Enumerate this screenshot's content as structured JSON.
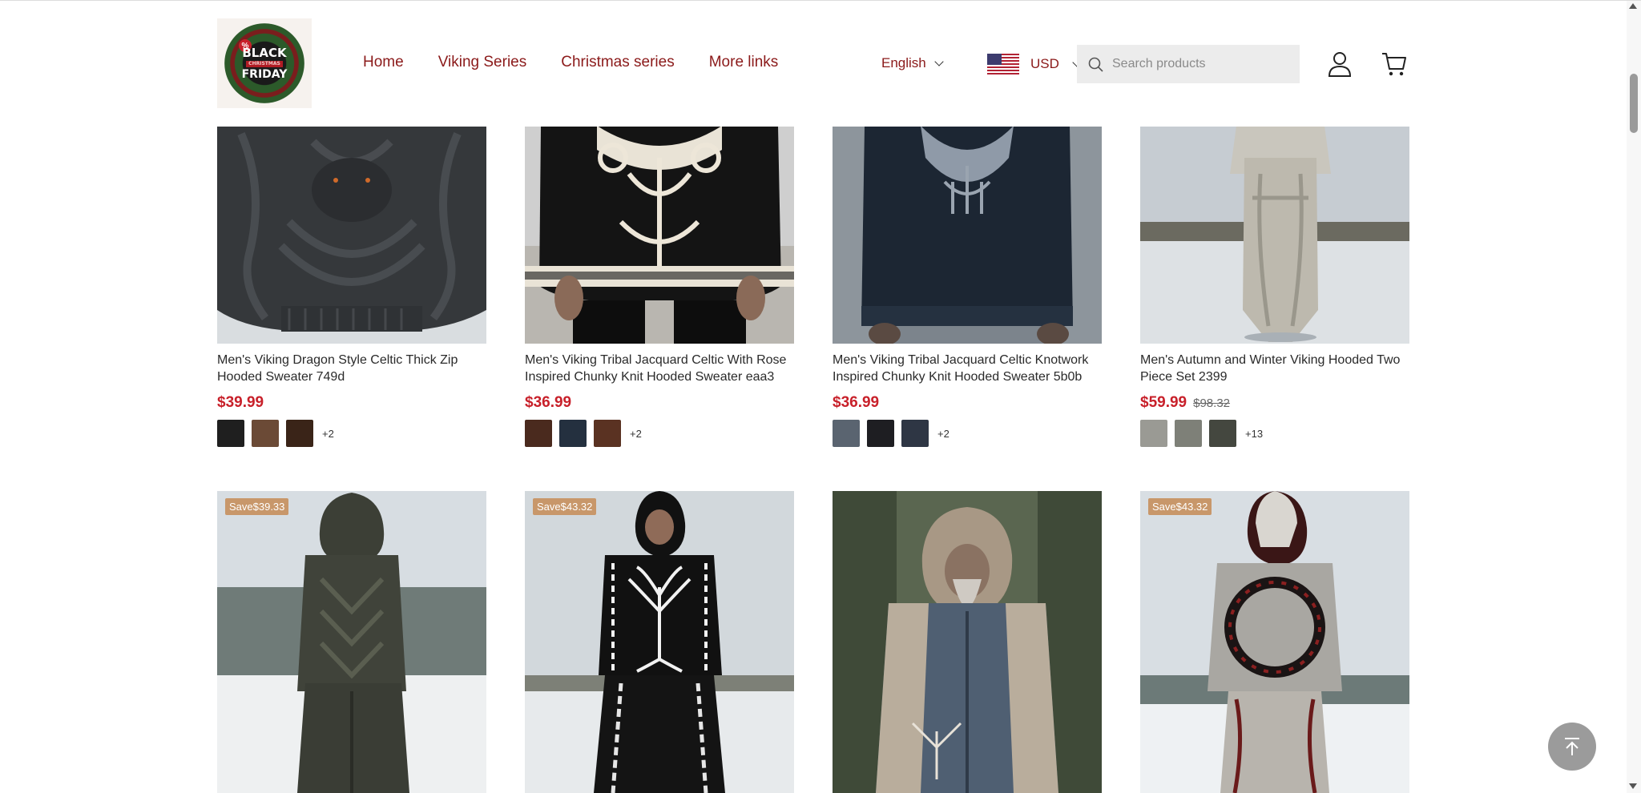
{
  "header": {
    "logo": {
      "line1": "BLACK",
      "line2": "CHRISTMAS",
      "line3": "FRIDAY",
      "percent": "%"
    },
    "nav": [
      {
        "label": "Home"
      },
      {
        "label": "Viking Series"
      },
      {
        "label": "Christmas series"
      },
      {
        "label": "More links"
      }
    ],
    "language": "English",
    "currency": "USD",
    "search": {
      "placeholder": "Search products",
      "value": ""
    }
  },
  "products_row1": [
    {
      "title": "Men's Viking Dragon Style Celtic Thick Zip Hooded Sweater 749d",
      "price": "$39.99",
      "old_price": "",
      "more_colors": "+2",
      "swatches": [
        "#1f1f1f",
        "#6b4a36",
        "#3a2418"
      ]
    },
    {
      "title": "Men's Viking Tribal Jacquard Celtic With Rose Inspired Chunky Knit Hooded Sweater eaa3",
      "price": "$36.99",
      "old_price": "",
      "more_colors": "+2",
      "swatches": [
        "#4a2a1e",
        "#24303f",
        "#5a3222"
      ]
    },
    {
      "title": "Men's Viking Tribal Jacquard Celtic Knotwork Inspired Chunky Knit Hooded Sweater 5b0b",
      "price": "$36.99",
      "old_price": "",
      "more_colors": "+2",
      "swatches": [
        "#5a6470",
        "#1e1e22",
        "#2e3644"
      ]
    },
    {
      "title": "Men's Autumn and Winter Viking Hooded Two Piece Set 2399",
      "price": "$59.99",
      "old_price": "$98.32",
      "more_colors": "+13",
      "swatches": [
        "#9a9a94",
        "#7e8078",
        "#44473f"
      ]
    }
  ],
  "products_row2": [
    {
      "badge": "Save$39.33"
    },
    {
      "badge": "Save$43.32"
    },
    {
      "badge": ""
    },
    {
      "badge": "Save$43.32"
    }
  ],
  "colors": {
    "accent": "#8b1a1a",
    "price": "#c8202a",
    "badge": "#c8976a"
  }
}
